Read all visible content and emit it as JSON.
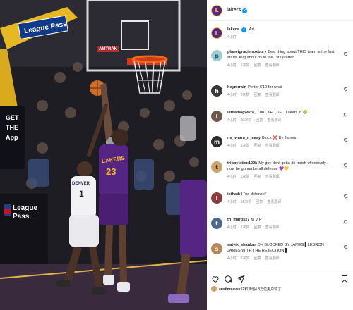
{
  "photo": {
    "banner_text": "League Pass",
    "side_banner_lines": [
      "GET",
      "THE",
      "App"
    ],
    "bottom_banner_text": "League Pass",
    "jersey_lakers_text": "LAKERS",
    "jersey_lakers_number": "23",
    "jersey_denver_text": "DENVER",
    "jersey_denver_number": "1",
    "board_text": "AMTRAK"
  },
  "post": {
    "author": "lakers",
    "author_avatar_glyph": "L",
    "verified_glyph": "✓",
    "caption_author": "lakers",
    "caption_text": "Art.",
    "caption_time": "4小时"
  },
  "comments": [
    {
      "user": "planetgracie.roxbury",
      "text": "Best thing about THIS team is the fast starts. Avg about 35 in the 1st Quarter.",
      "time": "4小时",
      "likes": "6次赞",
      "reply": "回复",
      "translate": "查看翻译",
      "avatar_glyph": "p"
    },
    {
      "user": "heymrrain",
      "text": "Porter 6'10 for what",
      "time": "4小时",
      "likes": "2次赞",
      "reply": "回复",
      "translate": "查看翻译",
      "avatar_glyph": "h"
    },
    {
      "user": "latitamagwaza_",
      "text": "OKC,KFC,UFC Lakers in 🤣",
      "time": "4小时",
      "likes": "39次赞",
      "reply": "回复",
      "translate": "查看翻译",
      "avatar_glyph": "l"
    },
    {
      "user": "mr_warm_n_easy",
      "text": "Block ❌ By James",
      "time": "4小时",
      "likes": "1次赞",
      "reply": "回复",
      "translate": "查看翻译",
      "avatar_glyph": "m"
    },
    {
      "user": "trippyistixx100k",
      "text": "My guy dont gotta do much offensively , now he gunna be all defense 💜💛",
      "time": "4小时",
      "likes": "2次赞",
      "reply": "回复",
      "translate": "查看翻译",
      "avatar_glyph": "t"
    },
    {
      "user": "isthatk4",
      "text": "\"no defense\"",
      "time": "4小时",
      "likes": "15次赞",
      "reply": "回复",
      "translate": "查看翻译",
      "avatar_glyph": "i"
    },
    {
      "user": "th_marqsx7",
      "text": "M V P",
      "time": "4小时",
      "likes": "1次赞",
      "reply": "回复",
      "translate": "查看翻译",
      "avatar_glyph": "t"
    },
    {
      "user": "satvik_shankar",
      "text": "OH BLOCKED BY JAMES ▌LEBRON JAMES WITH THE REJECTION ▌",
      "time": "4小时",
      "likes": "2次赞",
      "reply": "回复",
      "translate": "查看翻译",
      "avatar_glyph": "s"
    }
  ],
  "likes_line": {
    "user": "austinreaves12",
    "text": "和其他4.8万位用户赞了"
  },
  "colors": {
    "lakers_purple": "#552583",
    "lakers_gold": "#fdb927",
    "verified_blue": "#0095f6",
    "meta_gray": "#8e8e8e"
  },
  "icons": [
    "heart-icon",
    "comment-icon",
    "share-icon",
    "bookmark-icon",
    "verified-icon"
  ]
}
